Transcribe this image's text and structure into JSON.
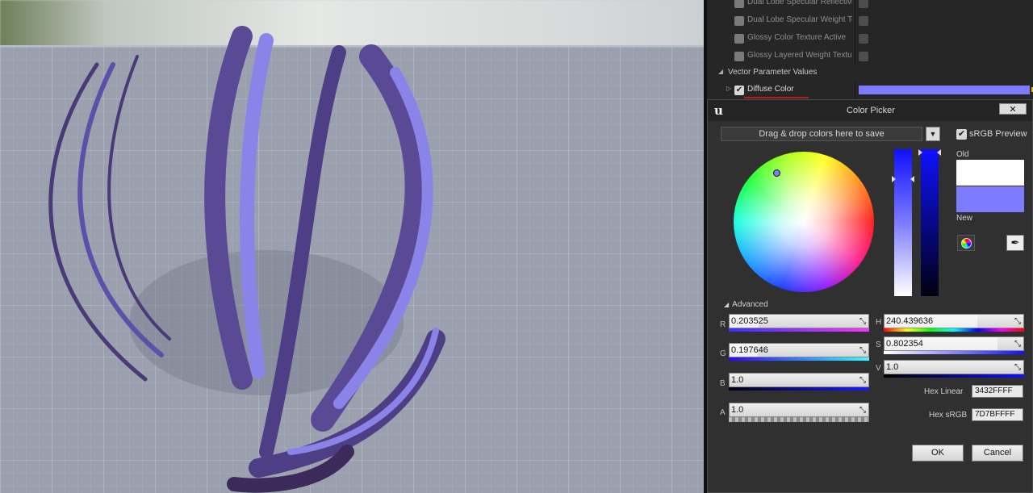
{
  "details_panel": {
    "properties": [
      {
        "label": "Dual Lobe Specular Reflectivi"
      },
      {
        "label": "Dual Lobe Specular Weight Te"
      },
      {
        "label": "Glossy Color Texture Active"
      },
      {
        "label": "Glossy Layered Weight Textu"
      }
    ],
    "vector_section": "Vector Parameter Values",
    "diffuse_label": "Diffuse Color",
    "diffuse_color": "#7D7BFF"
  },
  "color_picker": {
    "title": "Color Picker",
    "swatch_placeholder": "Drag & drop colors here to save",
    "srgb_preview_label": "sRGB Preview",
    "old_label": "Old",
    "new_label": "New",
    "old_color": "#FFFFFF",
    "new_color": "#7D7BFF",
    "advanced_label": "Advanced",
    "channels_left": [
      {
        "label": "R",
        "value": "0.203525"
      },
      {
        "label": "G",
        "value": "0.197646"
      },
      {
        "label": "B",
        "value": "1.0"
      },
      {
        "label": "A",
        "value": "1.0"
      }
    ],
    "channels_right": [
      {
        "label": "H",
        "value": "240.439636"
      },
      {
        "label": "S",
        "value": "0.802354"
      },
      {
        "label": "V",
        "value": "1.0"
      }
    ],
    "hex_linear_label": "Hex Linear",
    "hex_linear_value": "3432FFFF",
    "hex_srgb_label": "Hex sRGB",
    "hex_srgb_value": "7D7BFFFF",
    "ok_label": "OK",
    "cancel_label": "Cancel",
    "close_label": "✕"
  }
}
